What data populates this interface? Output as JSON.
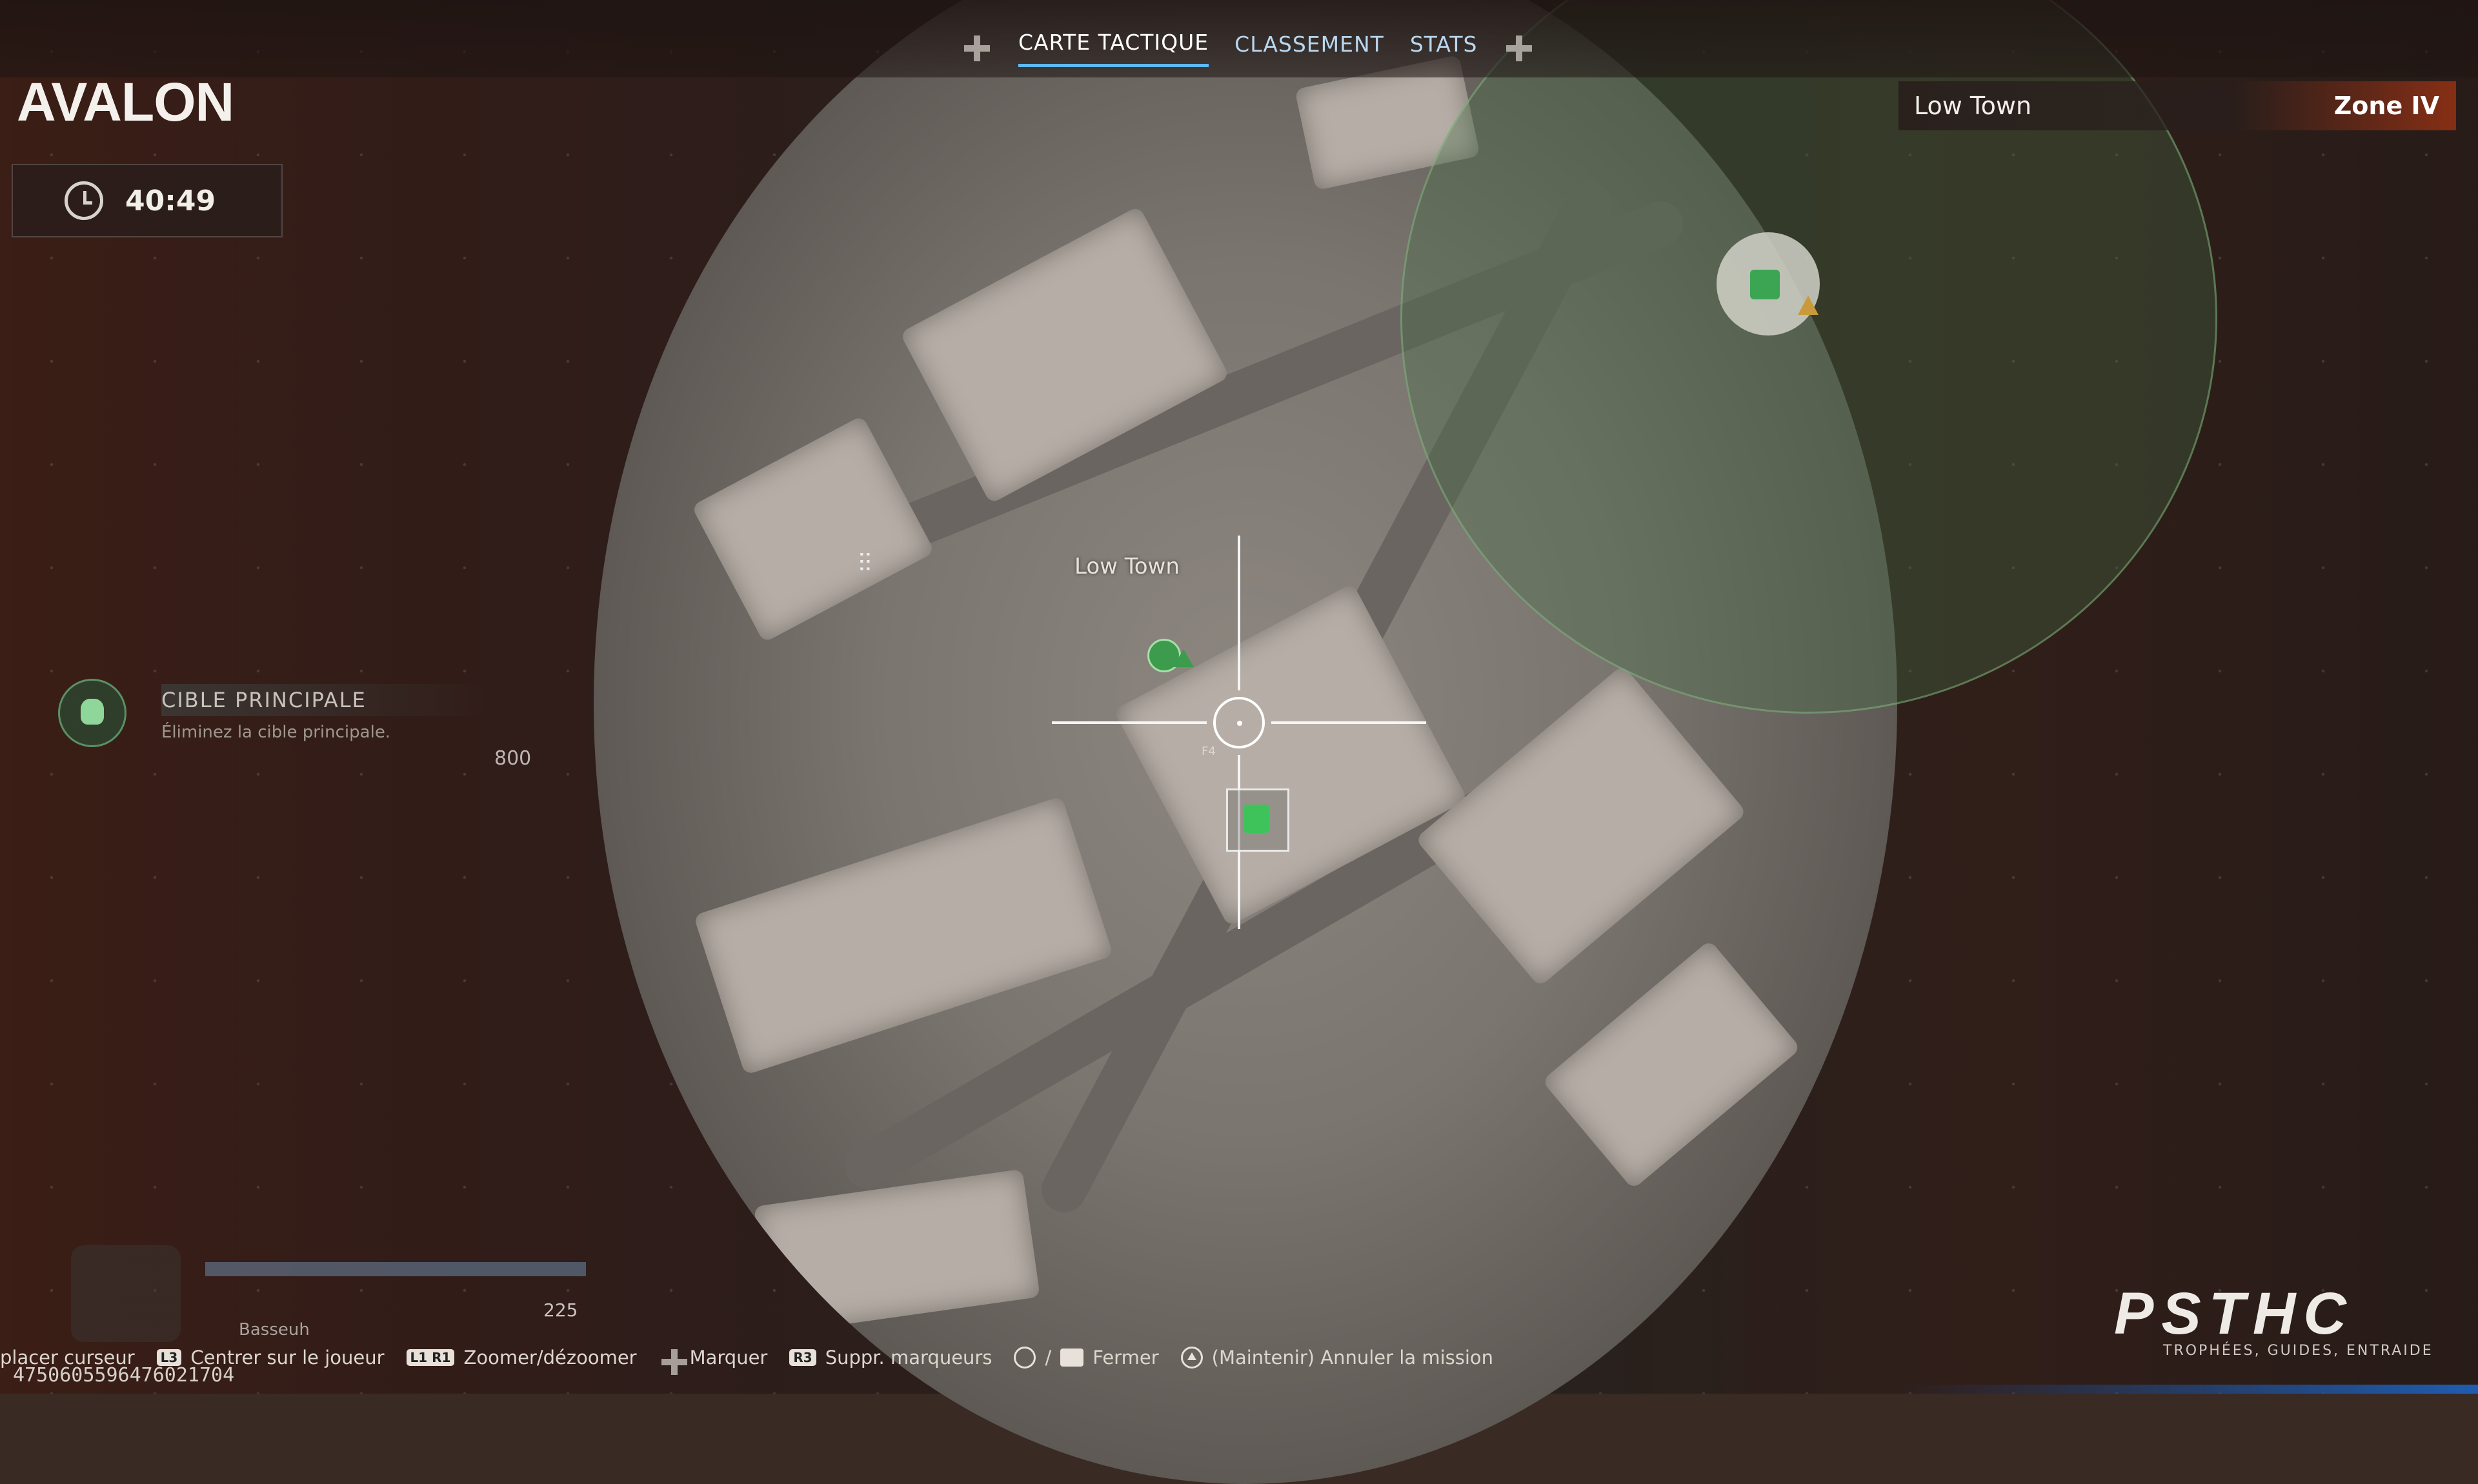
{
  "header": {
    "tabs": [
      {
        "label": "CARTE TACTIQUE",
        "active": true
      },
      {
        "label": "CLASSEMENT",
        "active": false
      },
      {
        "label": "STATS",
        "active": false
      }
    ]
  },
  "mission": {
    "name": "AVALON",
    "timer": "40:49"
  },
  "location": {
    "area": "Low Town",
    "zone": "Zone IV"
  },
  "objective": {
    "title": "CIBLE PRINCIPALE",
    "description": "Éliminez la cible principale.",
    "points": "800"
  },
  "map": {
    "area_label": "Low Town",
    "grid_label": "F4",
    "icons": [
      "crosshair-icon",
      "player-marker-icon",
      "objective-marker-icon",
      "skull-marker-icon",
      "ammo-icon"
    ]
  },
  "hud": {
    "player_name": "Basseuh",
    "ammo": "225"
  },
  "controls": [
    {
      "key": "",
      "label": "placer curseur"
    },
    {
      "key": "L3",
      "label": "Centrer sur le joueur"
    },
    {
      "key": "L1 R1",
      "label": "Zoomer/dézoomer"
    },
    {
      "key": "",
      "label": "Marquer"
    },
    {
      "key": "R3",
      "label": "Suppr. marqueurs"
    },
    {
      "key": "/",
      "label": "Fermer"
    },
    {
      "key": "",
      "label": "(Maintenir) Annuler la mission"
    }
  ],
  "session_id": "4750605596476021704",
  "watermark": {
    "logo": "PSTHC",
    "tagline": "TROPHÉES, GUIDES, ENTRAIDE"
  },
  "colors": {
    "accent": "#5fb8f0",
    "zone": "#c43c12",
    "marker_green": "#3dc35a"
  }
}
